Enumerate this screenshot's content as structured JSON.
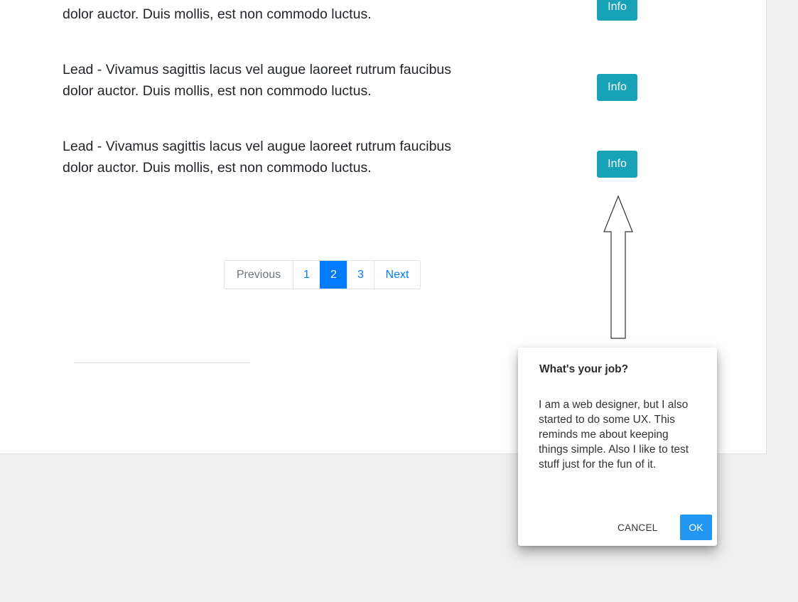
{
  "leads": [
    {
      "text": "dolor auctor. Duis mollis, est non commodo luctus.",
      "button_label": "Info"
    },
    {
      "text": "Lead - Vivamus sagittis lacus vel augue laoreet rutrum faucibus dolor auctor. Duis mollis, est non commodo luctus.",
      "button_label": "Info"
    },
    {
      "text": "Lead - Vivamus sagittis lacus vel augue laoreet rutrum faucibus dolor auctor. Duis mollis, est non commodo luctus.",
      "button_label": "Info"
    }
  ],
  "pagination": {
    "previous_label": "Previous",
    "pages": [
      "1",
      "2",
      "3"
    ],
    "active_page": "2",
    "next_label": "Next"
  },
  "dialog": {
    "title": "What's your job?",
    "body": "I am a web designer, but I also started to do some UX. This reminds me about keeping things simple. Also I like to test stuff just for the fun of it.",
    "cancel_label": "CANCEL",
    "ok_label": "OK"
  },
  "colors": {
    "info_button": "#17a2b8",
    "pagination_active": "#007bff",
    "ok_button": "#2196f3",
    "page_background": "#efefef"
  },
  "icons": {
    "arrow": "up-arrow-icon"
  }
}
